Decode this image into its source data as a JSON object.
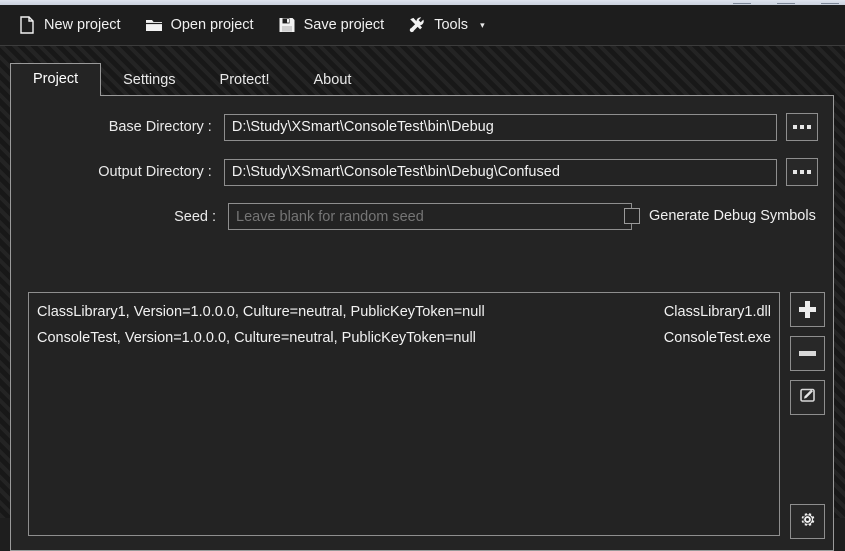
{
  "window": {
    "controls": [
      "minimize",
      "maximize",
      "close"
    ]
  },
  "toolbar": {
    "items": [
      {
        "label": "New project",
        "icon": "new-file-icon"
      },
      {
        "label": "Open project",
        "icon": "open-folder-icon"
      },
      {
        "label": "Save project",
        "icon": "floppy-disk-icon"
      },
      {
        "label": "Tools",
        "icon": "tools-wrench-icon",
        "caret": "▾"
      }
    ]
  },
  "tabs": {
    "items": [
      {
        "label": "Project",
        "active": true
      },
      {
        "label": "Settings",
        "active": false
      },
      {
        "label": "Protect!",
        "active": false
      },
      {
        "label": "About",
        "active": false
      }
    ]
  },
  "project_tab": {
    "base_directory": {
      "label": "Base Directory :",
      "value": "D:\\Study\\XSmart\\ConsoleTest\\bin\\Debug",
      "browse_label": "..."
    },
    "output_directory": {
      "label": "Output Directory :",
      "value": "D:\\Study\\XSmart\\ConsoleTest\\bin\\Debug\\Confused",
      "browse_label": "..."
    },
    "seed": {
      "label": "Seed :",
      "value": "",
      "placeholder": "Leave blank for random seed"
    },
    "generate_debug_symbols": {
      "label": "Generate Debug Symbols",
      "checked": false
    },
    "assembly_list": {
      "rows": [
        {
          "assembly": "ClassLibrary1, Version=1.0.0.0, Culture=neutral, PublicKeyToken=null",
          "file": "ClassLibrary1.dll"
        },
        {
          "assembly": "ConsoleTest, Version=1.0.0.0, Culture=neutral, PublicKeyToken=null",
          "file": "ConsoleTest.exe"
        }
      ]
    },
    "list_actions": [
      {
        "name": "add-assembly-button",
        "icon": "plus-icon"
      },
      {
        "name": "remove-assembly-button",
        "icon": "minus-icon"
      },
      {
        "name": "edit-assembly-button",
        "icon": "edit-pencil-icon"
      }
    ],
    "settings_action": {
      "name": "assembly-settings-button",
      "icon": "gear-icon"
    }
  },
  "colors": {
    "background": "#1c1c1c",
    "panel": "#242424",
    "border": "#9a9a9a",
    "text": "#f0f0f0",
    "placeholder": "#8c8c8c",
    "titlebar": "#dfe4ee"
  }
}
